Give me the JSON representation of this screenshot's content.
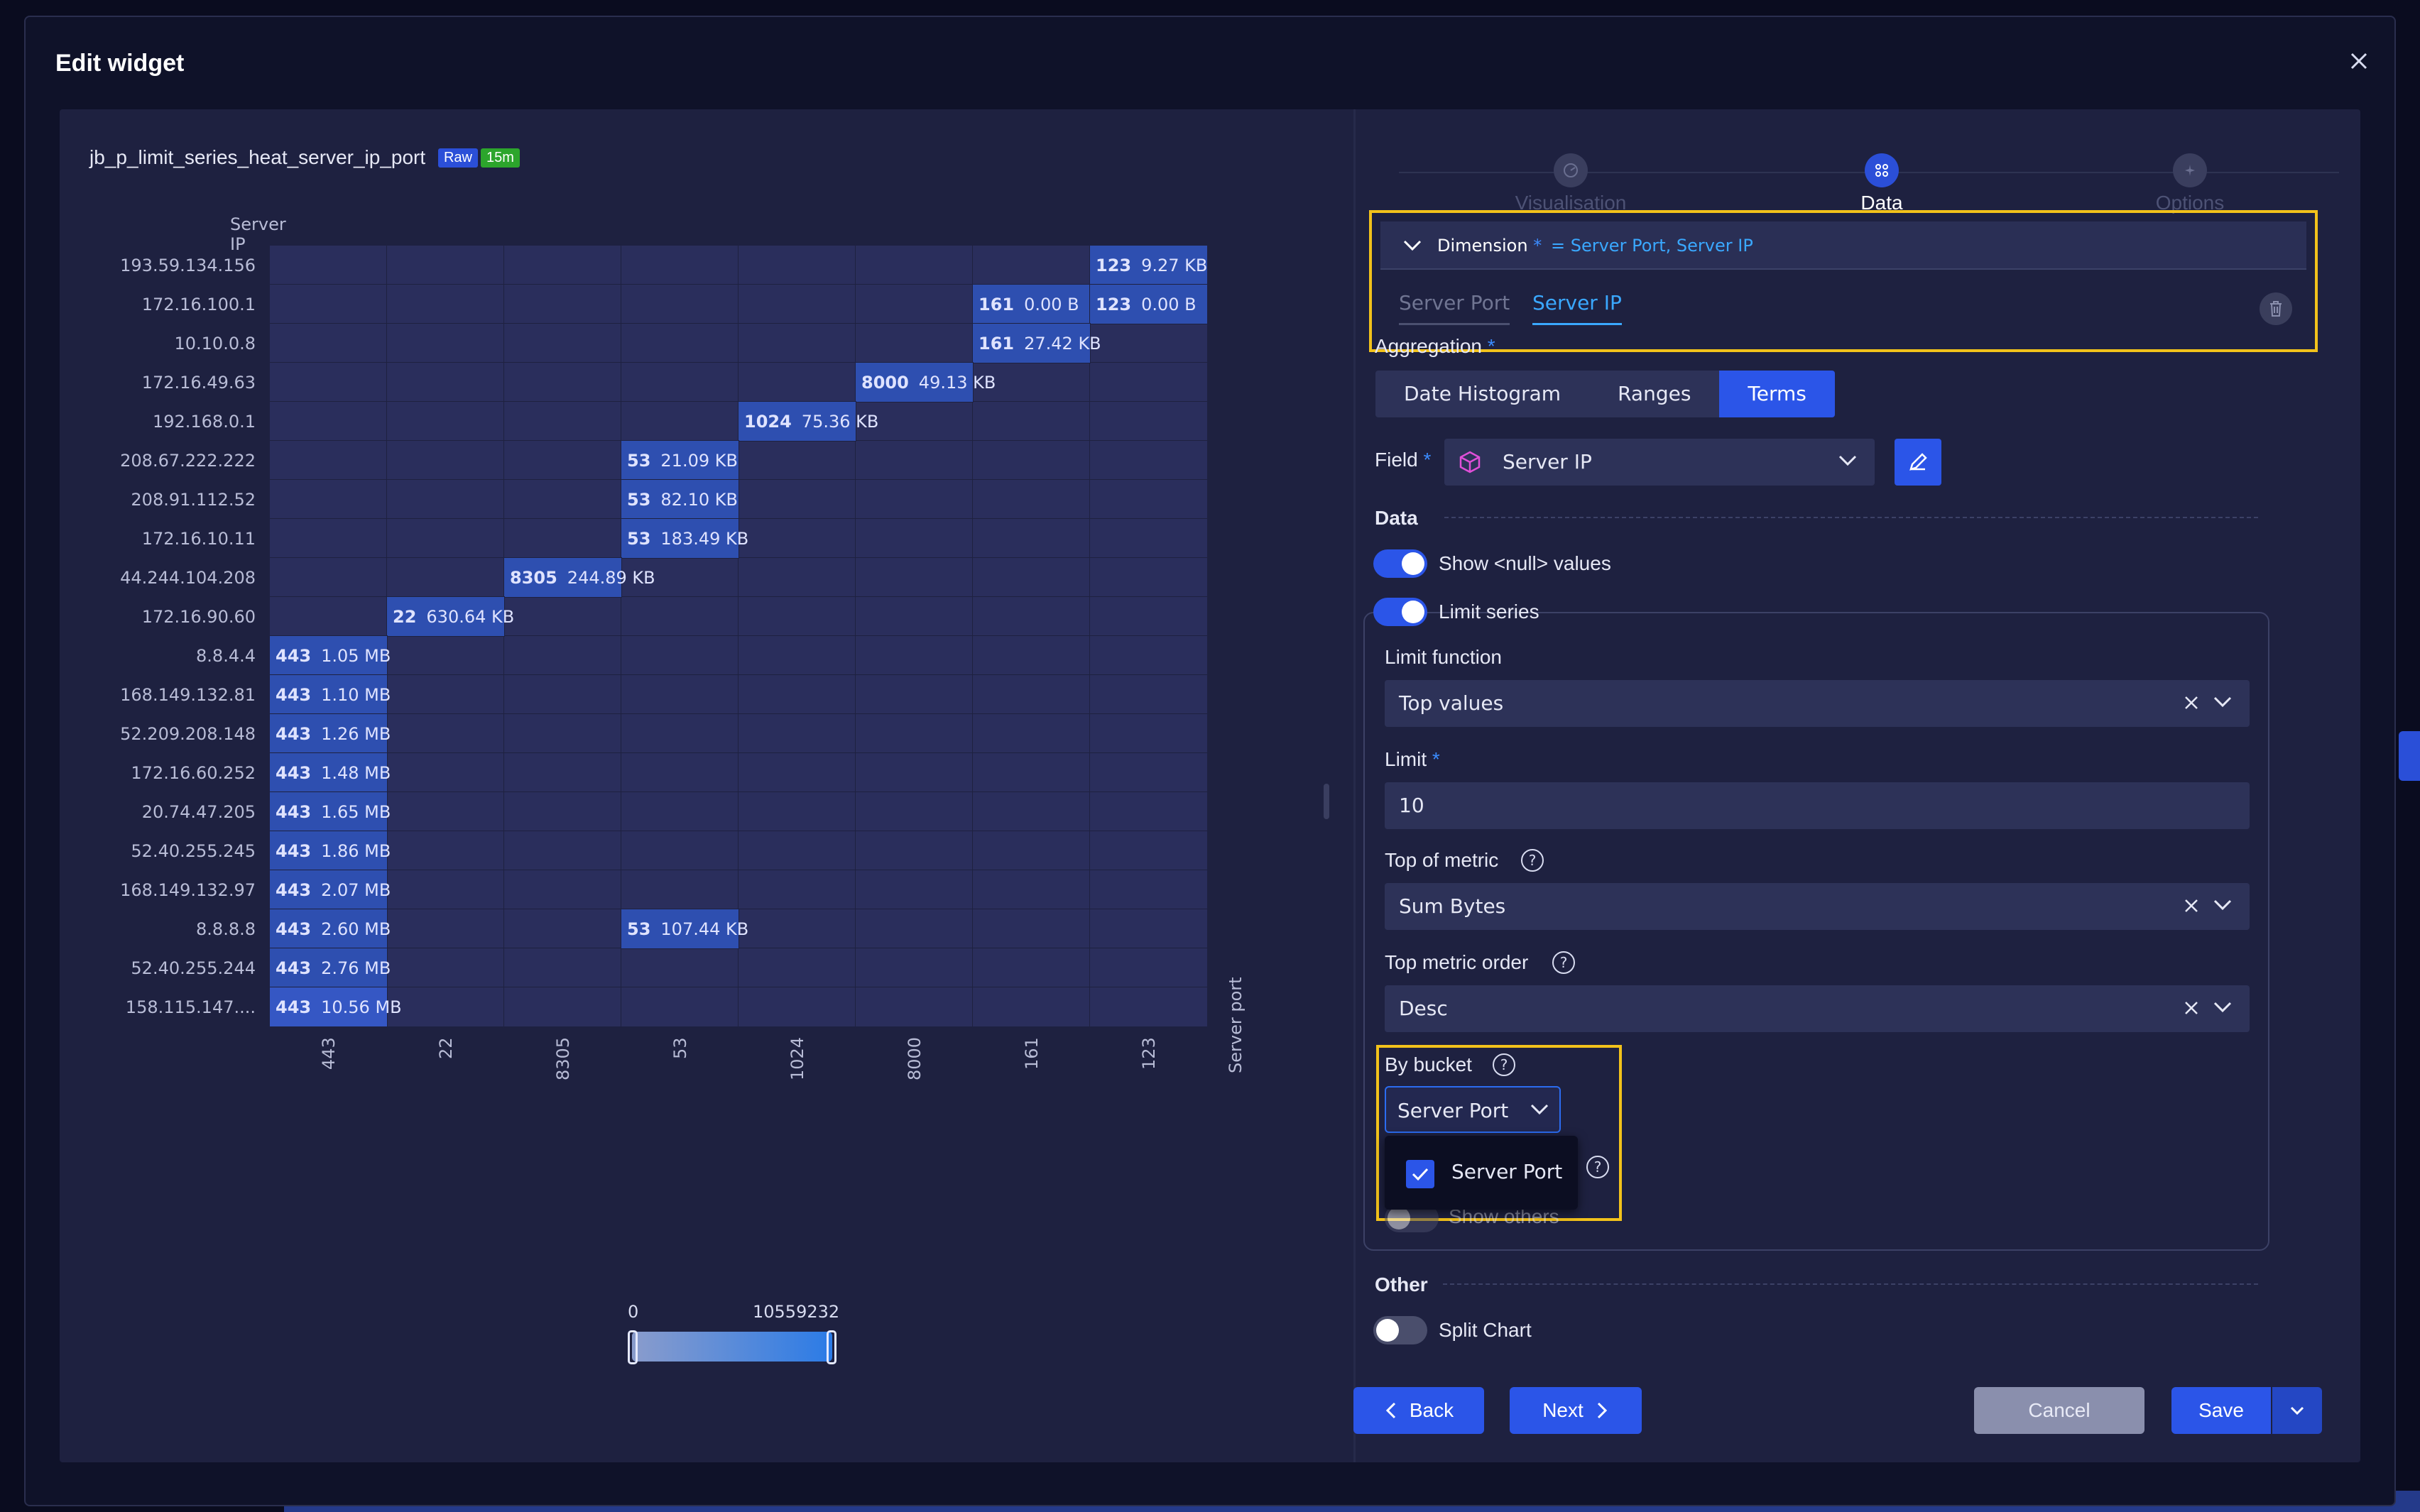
{
  "modal": {
    "title": "Edit widget"
  },
  "widget": {
    "name": "jb_p_limit_series_heat_server_ip_port",
    "badge_raw": "Raw",
    "badge_time": "15m"
  },
  "chart_data": {
    "type": "heatmap",
    "ylabel": "Server IP",
    "xlabel": "Server port",
    "x_categories": [
      "443",
      "22",
      "8305",
      "53",
      "1024",
      "8000",
      "161",
      "123"
    ],
    "y_categories": [
      "193.59.134.156",
      "172.16.100.1",
      "10.10.0.8",
      "172.16.49.63",
      "192.168.0.1",
      "208.67.222.222",
      "208.91.112.52",
      "172.16.10.11",
      "44.244.104.208",
      "172.16.90.60",
      "8.8.4.4",
      "168.149.132.81",
      "52.209.208.148",
      "172.16.60.252",
      "20.74.47.205",
      "52.40.255.245",
      "168.149.132.97",
      "8.8.8.8",
      "52.40.255.244",
      "158.115.147...."
    ],
    "cells": [
      {
        "y": "193.59.134.156",
        "x": "123",
        "key": "123",
        "value_label": "9.27 KB",
        "value": 9492
      },
      {
        "y": "172.16.100.1",
        "x": "161",
        "key": "161",
        "value_label": "0.00 B",
        "value": 0
      },
      {
        "y": "172.16.100.1",
        "x": "123",
        "key": "123",
        "value_label": "0.00 B",
        "value": 0
      },
      {
        "y": "10.10.0.8",
        "x": "161",
        "key": "161",
        "value_label": "27.42 KB",
        "value": 28078
      },
      {
        "y": "172.16.49.63",
        "x": "8000",
        "key": "8000",
        "value_label": "49.13 KB",
        "value": 50309
      },
      {
        "y": "192.168.0.1",
        "x": "1024",
        "key": "1024",
        "value_label": "75.36 KB",
        "value": 77169
      },
      {
        "y": "208.67.222.222",
        "x": "53",
        "key": "53",
        "value_label": "21.09 KB",
        "value": 21596
      },
      {
        "y": "208.91.112.52",
        "x": "53",
        "key": "53",
        "value_label": "82.10 KB",
        "value": 84070
      },
      {
        "y": "172.16.10.11",
        "x": "53",
        "key": "53",
        "value_label": "183.49 KB",
        "value": 187894
      },
      {
        "y": "44.244.104.208",
        "x": "8305",
        "key": "8305",
        "value_label": "244.89 KB",
        "value": 250767
      },
      {
        "y": "172.16.90.60",
        "x": "22",
        "key": "22",
        "value_label": "630.64 KB",
        "value": 645775
      },
      {
        "y": "8.8.4.4",
        "x": "443",
        "key": "443",
        "value_label": "1.05 MB",
        "value": 1101005
      },
      {
        "y": "168.149.132.81",
        "x": "443",
        "key": "443",
        "value_label": "1.10 MB",
        "value": 1153434
      },
      {
        "y": "52.209.208.148",
        "x": "443",
        "key": "443",
        "value_label": "1.26 MB",
        "value": 1321206
      },
      {
        "y": "172.16.60.252",
        "x": "443",
        "key": "443",
        "value_label": "1.48 MB",
        "value": 1551892
      },
      {
        "y": "20.74.47.205",
        "x": "443",
        "key": "443",
        "value_label": "1.65 MB",
        "value": 1730150
      },
      {
        "y": "52.40.255.245",
        "x": "443",
        "key": "443",
        "value_label": "1.86 MB",
        "value": 1950351
      },
      {
        "y": "168.149.132.97",
        "x": "443",
        "key": "443",
        "value_label": "2.07 MB",
        "value": 2170552
      },
      {
        "y": "8.8.8.8",
        "x": "443",
        "key": "443",
        "value_label": "2.60 MB",
        "value": 2726297
      },
      {
        "y": "8.8.8.8",
        "x": "53",
        "key": "53",
        "value_label": "107.44 KB",
        "value": 110019
      },
      {
        "y": "52.40.255.244",
        "x": "443",
        "key": "443",
        "value_label": "2.76 MB",
        "value": 2894070
      },
      {
        "y": "158.115.147....",
        "x": "443",
        "key": "443",
        "value_label": "10.56 MB",
        "value": 10559232
      }
    ],
    "legend_min": "0",
    "legend_max": "10559232"
  },
  "steps": [
    {
      "label": "Visualisation",
      "active": false
    },
    {
      "label": "Data",
      "active": true
    },
    {
      "label": "Options",
      "active": false
    }
  ],
  "dimension": {
    "label": "Dimension",
    "required_mark": "*",
    "value": "= Server Port, Server IP",
    "tabs": [
      "Server Port",
      "Server IP"
    ],
    "active_tab": "Server IP"
  },
  "aggregation": {
    "label": "Aggregation",
    "required_mark": "*",
    "options": [
      "Date Histogram",
      "Ranges",
      "Terms"
    ],
    "selected": "Terms"
  },
  "field": {
    "label": "Field",
    "required_mark": "*",
    "value": "Server IP"
  },
  "data_section": {
    "title": "Data",
    "show_null_label": "Show <null> values",
    "limit_series_label": "Limit series",
    "limit_function_label": "Limit function",
    "limit_function_value": "Top values",
    "limit_label": "Limit",
    "limit_required_mark": "*",
    "limit_value": "10",
    "top_metric_label": "Top of metric",
    "top_metric_value": "Sum Bytes",
    "top_metric_order_label": "Top metric order",
    "top_metric_order_value": "Desc",
    "by_bucket_label": "By bucket",
    "by_bucket_value": "Server Port",
    "dropdown_option": "Server Port",
    "show_others_label": "Show others",
    "help_glyph": "?"
  },
  "other_section": {
    "title": "Other",
    "split_chart_label": "Split Chart"
  },
  "footer": {
    "back": "Back",
    "next": "Next",
    "cancel": "Cancel",
    "save": "Save"
  },
  "colors": {
    "accent": "#2b55e8",
    "highlight": "#f2c21b",
    "link": "#3aa8ff"
  }
}
